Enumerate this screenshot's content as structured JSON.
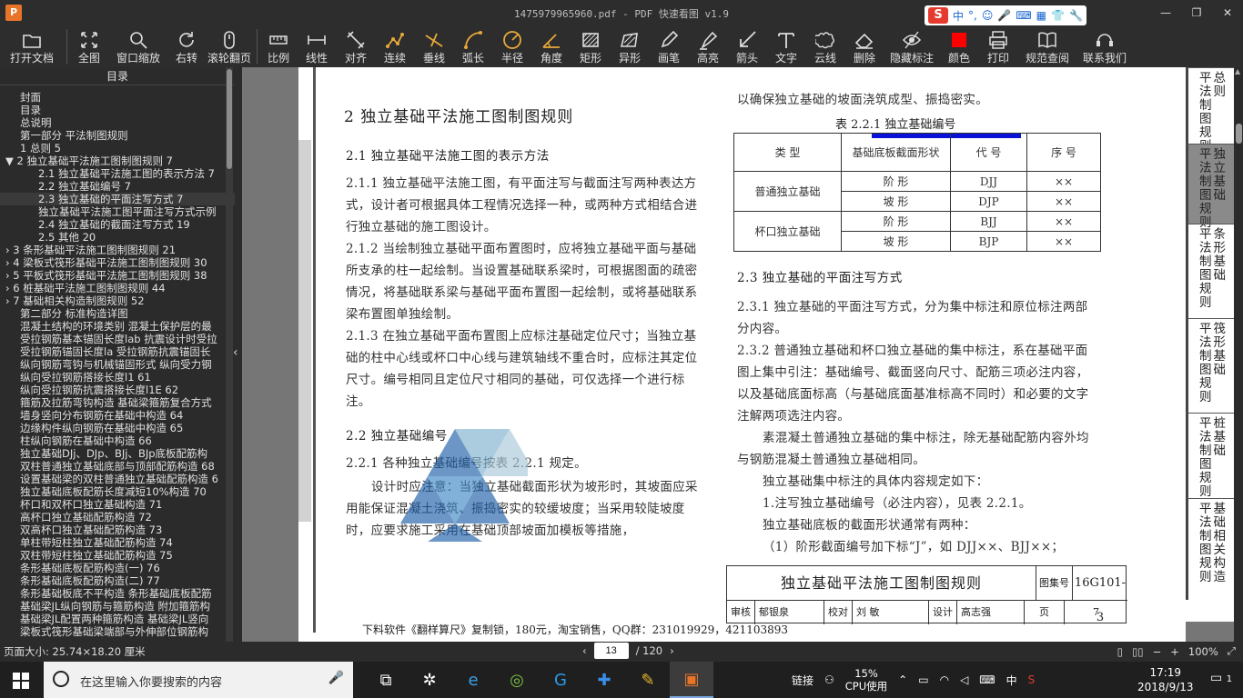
{
  "titlebar": {
    "logo": "P",
    "title": "1475979965960.pdf - PDF 快速看图 v1.9"
  },
  "ime": {
    "lang": "中",
    "punct": "°,"
  },
  "toolbar": [
    {
      "label": "打开文档",
      "icon": "folder-icon"
    },
    {
      "label": "全图",
      "icon": "fit-icon"
    },
    {
      "label": "窗口缩放",
      "icon": "zoom-icon"
    },
    {
      "label": "右转",
      "icon": "rotate-icon"
    },
    {
      "label": "滚轮翻页",
      "icon": "mouse-icon"
    },
    {
      "label": "比例",
      "icon": "scale-icon"
    },
    {
      "label": "线性",
      "icon": "linear-icon"
    },
    {
      "label": "对齐",
      "icon": "align-icon"
    },
    {
      "label": "连续",
      "icon": "continuous-icon"
    },
    {
      "label": "垂线",
      "icon": "perpendicular-icon"
    },
    {
      "label": "弧长",
      "icon": "arc-icon"
    },
    {
      "label": "半径",
      "icon": "radius-icon"
    },
    {
      "label": "角度",
      "icon": "angle-icon"
    },
    {
      "label": "矩形",
      "icon": "rect-icon"
    },
    {
      "label": "异形",
      "icon": "polygon-icon"
    },
    {
      "label": "画笔",
      "icon": "pen-icon"
    },
    {
      "label": "高亮",
      "icon": "highlight-icon"
    },
    {
      "label": "箭头",
      "icon": "arrow-icon"
    },
    {
      "label": "文字",
      "icon": "text-icon"
    },
    {
      "label": "云线",
      "icon": "cloud-icon"
    },
    {
      "label": "删除",
      "icon": "eraser-icon"
    },
    {
      "label": "隐藏标注",
      "icon": "hide-icon"
    },
    {
      "label": "颜色",
      "icon": "color-icon"
    },
    {
      "label": "打印",
      "icon": "print-icon"
    },
    {
      "label": "规范查阅",
      "icon": "book-icon"
    },
    {
      "label": "联系我们",
      "icon": "contact-icon"
    }
  ],
  "colors": {
    "annotation": "#ff0000",
    "accent": "#0b12d8"
  },
  "toc": {
    "title": "目录",
    "items": [
      {
        "label": "封面",
        "indent": 1
      },
      {
        "label": "目录",
        "indent": 1
      },
      {
        "label": "总说明",
        "indent": 1
      },
      {
        "label": "第一部分  平法制图规则",
        "indent": 1
      },
      {
        "label": "1 总则 5",
        "indent": 1
      },
      {
        "label": "▼ 2 独立基础平法施工图制图规则 7",
        "indent": 0
      },
      {
        "label": "2.1 独立基础平法施工图的表示方法 7",
        "indent": 3
      },
      {
        "label": "2.2 独立基础编号 7",
        "indent": 3
      },
      {
        "label": "2.3 独立基础的平面注写方式 7",
        "indent": 3,
        "active": true
      },
      {
        "label": "独立基础平法施工图平面注写方式示例",
        "indent": 3
      },
      {
        "label": "2.4 独立基础的截面注写方式 19",
        "indent": 3
      },
      {
        "label": "2.5 其他 20",
        "indent": 3
      },
      {
        "label": "› 3 条形基础平法施工图制图规则 21",
        "indent": 0
      },
      {
        "label": "› 4 梁板式筏形基础平法施工图制图规则 30",
        "indent": 0
      },
      {
        "label": "› 5 平板式筏形基础平法施工图制图规则 38",
        "indent": 0
      },
      {
        "label": "› 6 桩基础平法施工图制图规则 44",
        "indent": 0
      },
      {
        "label": "› 7 基础相关构造制图规则 52",
        "indent": 0
      },
      {
        "label": "第二部分  标准构造详图",
        "indent": 1
      },
      {
        "label": "混凝土结构的环境类别 混凝土保护层的最",
        "indent": 1
      },
      {
        "label": "受拉钢筋基本锚固长度lab 抗震设计时受拉",
        "indent": 1
      },
      {
        "label": "受拉钢筋锚固长度la 受拉钢筋抗震锚固长",
        "indent": 1
      },
      {
        "label": "纵向钢筋弯钩与机械锚固形式 纵向受力钢",
        "indent": 1
      },
      {
        "label": "纵向受拉钢筋搭接长度l1 61",
        "indent": 1
      },
      {
        "label": "纵向受拉钢筋抗震搭接长度l1E 62",
        "indent": 1
      },
      {
        "label": "箍筋及拉筋弯钩构造 基础梁箍筋复合方式",
        "indent": 1
      },
      {
        "label": "墙身竖向分布钢筋在基础中构造 64",
        "indent": 1
      },
      {
        "label": "边缘构件纵向钢筋在基础中构造 65",
        "indent": 1
      },
      {
        "label": "柱纵向钢筋在基础中构造 66",
        "indent": 1
      },
      {
        "label": "独立基础DJj、DJp、BJj、BJp底板配筋构",
        "indent": 1
      },
      {
        "label": "双柱普通独立基础底部与顶部配筋构造 68",
        "indent": 1
      },
      {
        "label": "设置基础梁的双柱普通独立基础配筋构造 6",
        "indent": 1
      },
      {
        "label": "独立基础底板配筋长度减短10%构造 70",
        "indent": 1
      },
      {
        "label": "杯口和双杯口独立基础构造 71",
        "indent": 1
      },
      {
        "label": "高杯口独立基础配筋构造 72",
        "indent": 1
      },
      {
        "label": "双高杯口独立基础配筋构造 73",
        "indent": 1
      },
      {
        "label": "单柱带短柱独立基础配筋构造 74",
        "indent": 1
      },
      {
        "label": "双柱带短柱独立基础配筋构造 75",
        "indent": 1
      },
      {
        "label": "条形基础底板配筋构造(一) 76",
        "indent": 1
      },
      {
        "label": "条形基础底板配筋构造(二) 77",
        "indent": 1
      },
      {
        "label": "条形基础板底不平构造 条形基础底板配筋",
        "indent": 1
      },
      {
        "label": "基础梁JL纵向钢筋与箍筋构造 附加箍筋构",
        "indent": 1
      },
      {
        "label": "基础梁JL配置两种箍筋构造 基础梁JL竖向",
        "indent": 1
      },
      {
        "label": "梁板式筏形基础梁端部与外伸部位钢筋构",
        "indent": 1
      }
    ]
  },
  "page": {
    "chapter": "2    独立基础平法施工图制图规则",
    "s21": "2.1  独立基础平法施工图的表示方法",
    "p211": "2.1.1  独立基础平法施工图，有平面注写与截面注写两种表达方式，设计者可根据具体工程情况选择一种，或两种方式相结合进行独立基础的施工图设计。",
    "p212": "2.1.2  当绘制独立基础平面布置图时，应将独立基础平面与基础所支承的柱一起绘制。当设置基础联系梁时，可根据图面的疏密情况，将基础联系梁与基础平面布置图一起绘制，或将基础联系梁布置图单独绘制。",
    "p213": "2.1.3  在独立基础平面布置图上应标注基础定位尺寸；当独立基础的柱中心线或杯口中心线与建筑轴线不重合时，应标注其定位尺寸。编号相同且定位尺寸相同的基础，可仅选择一个进行标注。",
    "s22": "2.2  独立基础编号",
    "p221": "2.2.1  各种独立基础编号按表 2.2.1 规定。",
    "p_note": "设计时应注意：当独立基础截面形状为坡形时，其坡面应采用能保证混凝土浇筑、振捣密实的较缓坡度；当采用较陡坡度时，应要求施工采用在基础顶部坡面加模板等措施，",
    "p_cont": "以确保独立基础的坡面浇筑成型、振捣密实。",
    "table_caption": "表 2.2.1    独立基础编号",
    "table": {
      "headers": [
        "类 型",
        "基础底板截面形状",
        "代 号",
        "序 号"
      ],
      "rows": [
        [
          "普通独立基础",
          "阶 形",
          "DJJ",
          "××"
        ],
        [
          "",
          "坡 形",
          "DJP",
          "××"
        ],
        [
          "杯口独立基础",
          "阶 形",
          "BJJ",
          "××"
        ],
        [
          "",
          "坡 形",
          "BJP",
          "××"
        ]
      ]
    },
    "s23": "2.3  独立基础的平面注写方式",
    "p231": "2.3.1  独立基础的平面注写方式，分为集中标注和原位标注两部分内容。",
    "p232": "2.3.2  普通独立基础和杯口独立基础的集中标注，系在基础平面图上集中引注：基础编号、截面竖向尺寸、配筋三项必注内容，以及基础底面标高（与基础底面基准标高不同时）和必要的文字注解两项选注内容。",
    "p_b1": "素混凝土普通独立基础的集中标注，除无基础配筋内容外均与钢筋混凝土普通独立基础相同。",
    "p_b2": "独立基础集中标注的具体内容规定如下：",
    "p_b3": "1.注写独立基础编号（必注内容），见表 2.2.1。",
    "p_b4": "独立基础底板的截面形状通常有两种：",
    "p_b5": "（1）阶形截面编号加下标“J”，如 DJJ××、BJJ××；",
    "titleblock": {
      "title": "独立基础平法施工图制图规则",
      "fig_label": "图集号",
      "code": "16G101-3",
      "row2": [
        "审核",
        "郁银泉",
        "校对",
        "刘  敏",
        "设计",
        "高志强",
        "页",
        "7"
      ]
    },
    "footer_ad": "下料软件《翻样算尺》复制锁，180元，淘宝销售，QQ群：231019929，421103893",
    "side_tabs": [
      {
        "a": "平法制图规则",
        "b": "总则",
        "active": false
      },
      {
        "a": "平法制图规则",
        "b": "独立基础",
        "active": true
      },
      {
        "a": "平法制图规则",
        "b": "条形基础",
        "active": false
      },
      {
        "a": "平法制图规则",
        "b": "筏形基础",
        "active": false
      },
      {
        "a": "平法制图规则",
        "b": "桩基础",
        "active": false
      },
      {
        "a": "平法制图规则",
        "b": "基础相关构造",
        "active": false
      }
    ]
  },
  "status": {
    "page_size": "页面大小: 25.74×18.20 厘米",
    "page_num": "13",
    "page_total": "/ 120",
    "zoom": "100%"
  },
  "taskbar": {
    "search_placeholder": "在这里输入你要搜索的内容",
    "link": "链接",
    "cpu": "15%",
    "cpu_label": "CPU使用",
    "lang": "中",
    "time": "17:19",
    "date": "2018/9/13",
    "notif_count": "1"
  }
}
